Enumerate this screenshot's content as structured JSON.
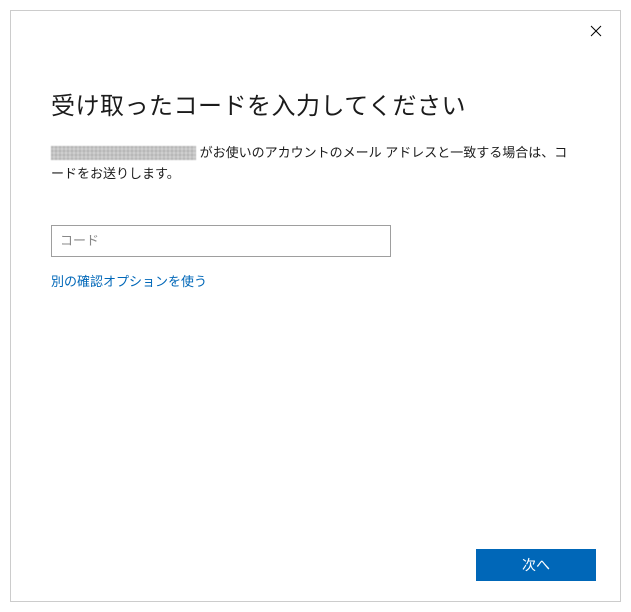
{
  "header": {
    "title": "受け取ったコードを入力してください"
  },
  "description": {
    "suffix": " がお使いのアカウントのメール アドレスと一致する場合は、コードをお送りします。"
  },
  "form": {
    "code_placeholder": "コード",
    "alt_option_label": "別の確認オプションを使う"
  },
  "actions": {
    "next_label": "次へ"
  }
}
